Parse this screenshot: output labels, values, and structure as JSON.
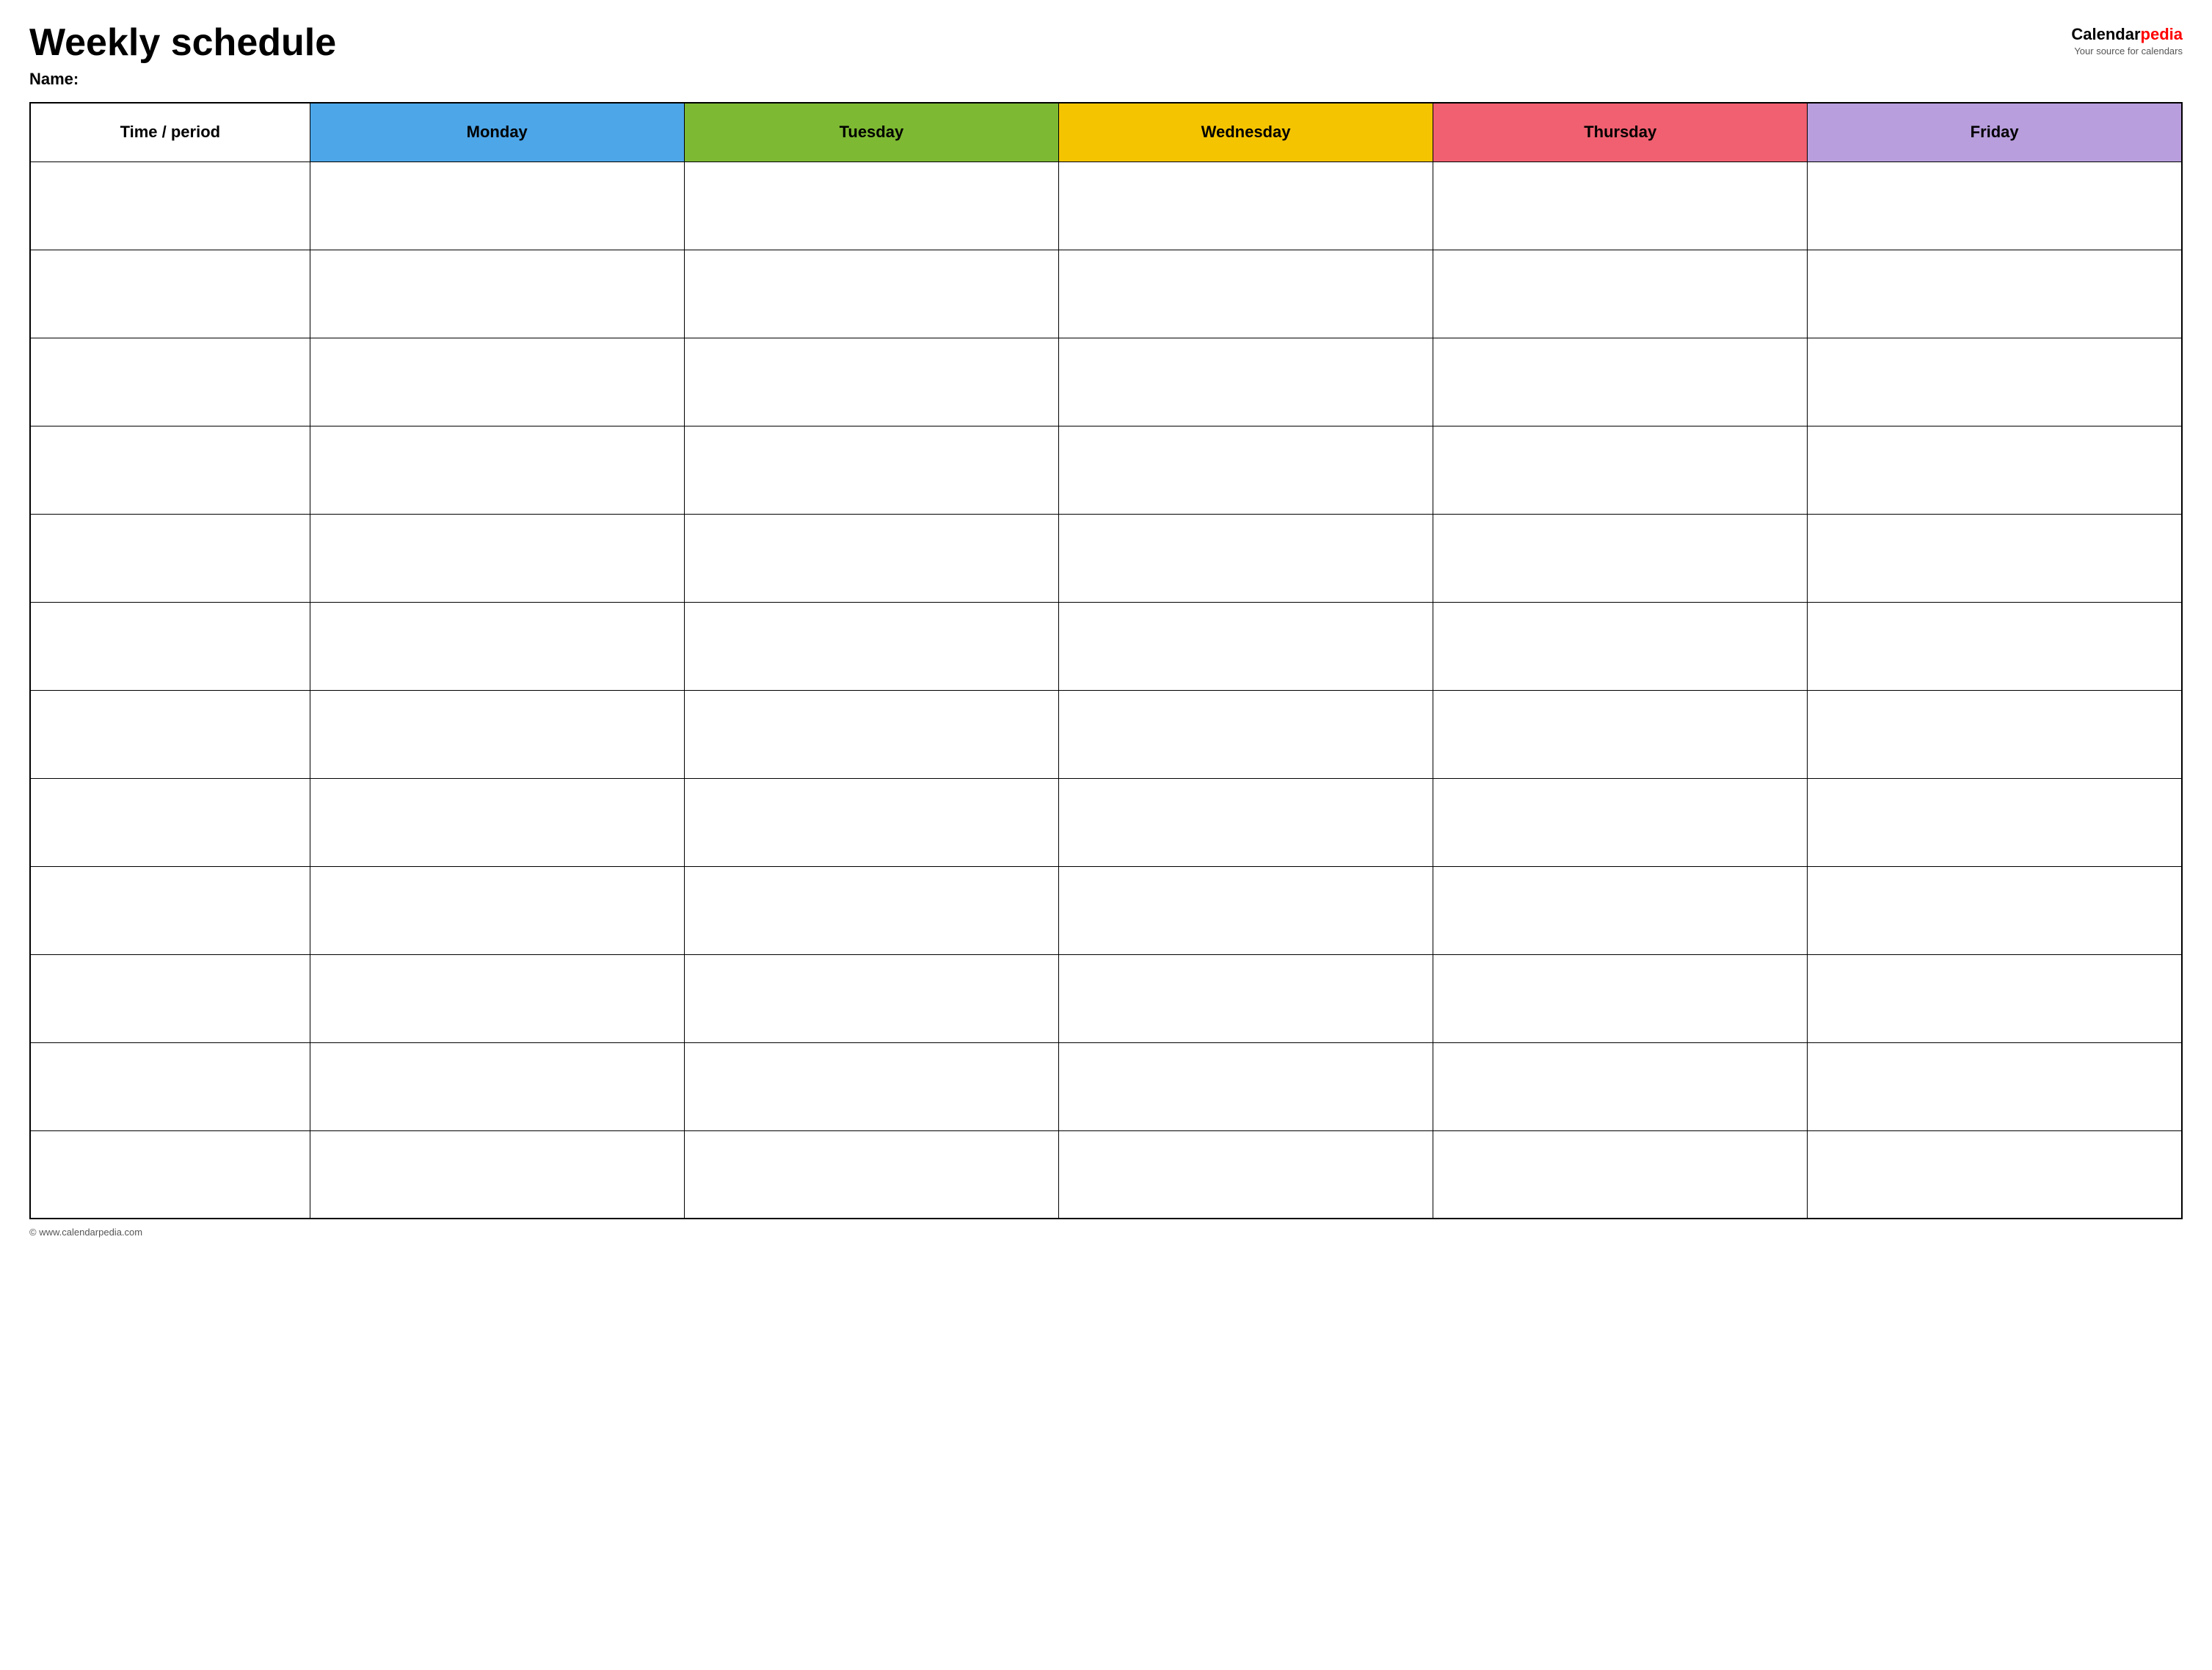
{
  "header": {
    "title": "Weekly schedule",
    "logo_calendar": "Calendar",
    "logo_pedia": "pedia",
    "logo_tagline": "Your source for calendars"
  },
  "name_label": "Name:",
  "table": {
    "columns": [
      {
        "key": "time",
        "label": "Time / period",
        "color": "#ffffff"
      },
      {
        "key": "monday",
        "label": "Monday",
        "color": "#4da6e8"
      },
      {
        "key": "tuesday",
        "label": "Tuesday",
        "color": "#7db933"
      },
      {
        "key": "wednesday",
        "label": "Wednesday",
        "color": "#f5c400"
      },
      {
        "key": "thursday",
        "label": "Thursday",
        "color": "#f06070"
      },
      {
        "key": "friday",
        "label": "Friday",
        "color": "#b89edc"
      }
    ],
    "row_count": 12
  },
  "footer": {
    "url": "© www.calendarpedia.com"
  }
}
